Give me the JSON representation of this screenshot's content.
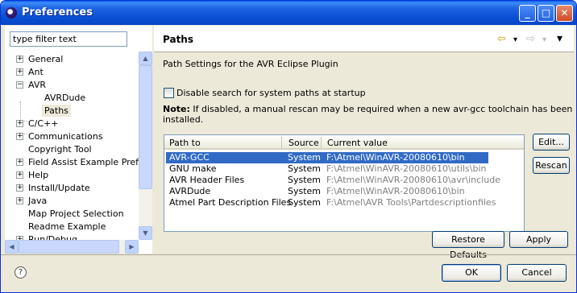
{
  "window": {
    "title": "Preferences",
    "buttons": {
      "minimize": "_",
      "maximize": "□",
      "close": "✕"
    }
  },
  "filter": {
    "value": "type filter text"
  },
  "tree": [
    {
      "label": "General",
      "expander": "+"
    },
    {
      "label": "Ant",
      "expander": "+"
    },
    {
      "label": "AVR",
      "expander": "−"
    },
    {
      "label": "AVRDude",
      "expander": ""
    },
    {
      "label": "Paths",
      "expander": ""
    },
    {
      "label": "C/C++",
      "expander": "+"
    },
    {
      "label": "Communications",
      "expander": "+"
    },
    {
      "label": "Copyright Tool",
      "expander": ""
    },
    {
      "label": "Field Assist Example Prefere",
      "expander": "+"
    },
    {
      "label": "Help",
      "expander": "+"
    },
    {
      "label": "Install/Update",
      "expander": "+"
    },
    {
      "label": "Java",
      "expander": "+"
    },
    {
      "label": "Map Project Selection",
      "expander": ""
    },
    {
      "label": "Readme Example",
      "expander": ""
    },
    {
      "label": "Run/Debug",
      "expander": "+"
    }
  ],
  "page": {
    "title": "Paths",
    "description": "Path Settings for the AVR Eclipse Plugin",
    "checkbox_label": "Disable search for system paths at startup",
    "note_bold": "Note:",
    "note_text": "If disabled, a manual rescan may be required when a new avr-gcc toolchain has been installed.",
    "nav": {
      "back": "⇦",
      "back_dropdown": "▾",
      "forward": "⇨",
      "forward_dropdown": "▾",
      "menu": "▾"
    }
  },
  "table": {
    "headers": [
      "Path to",
      "Source",
      "Current value"
    ],
    "rows": [
      [
        "AVR-GCC",
        "System",
        "F:\\Atmel\\WinAVR-20080610\\bin"
      ],
      [
        "GNU make",
        "System",
        "F:\\Atmel\\WinAVR-20080610\\utils\\bin"
      ],
      [
        "AVR Header Files",
        "System",
        "F:\\Atmel\\WinAVR-20080610\\avr\\include"
      ],
      [
        "AVRDude",
        "System",
        "F:\\Atmel\\WinAVR-20080610\\bin"
      ],
      [
        "Atmel Part Description Files",
        "System",
        "F:\\Atmel\\AVR Tools\\Partdescriptionfiles"
      ]
    ],
    "selected_row": 0
  },
  "buttons": {
    "edit": "Edit...",
    "rescan": "Rescan",
    "restore_defaults": "Restore Defaults",
    "apply": "Apply",
    "ok": "OK",
    "cancel": "Cancel",
    "help": "?"
  },
  "colors": {
    "selection": "#316ac5",
    "titlebar": "#0a4fd4",
    "dialog_bg": "#ece9d8"
  }
}
